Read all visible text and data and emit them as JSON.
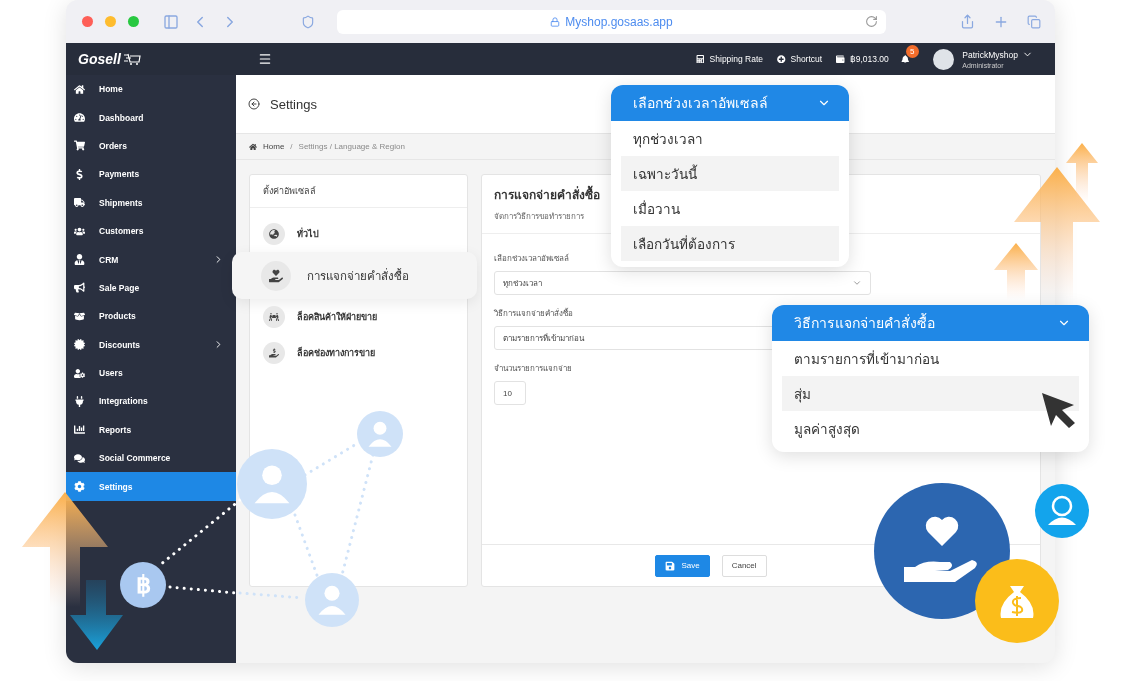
{
  "browser": {
    "url": "Myshop.gosaas.app"
  },
  "header": {
    "logo": "Gosell",
    "shipping": "Shipping Rate",
    "shortcut": "Shortcut",
    "balance": "฿9,013.00",
    "notifications": "5",
    "user_name": "PatrickMyshop",
    "user_role": "Administrator"
  },
  "sidebar": {
    "items": [
      {
        "label": "Home",
        "has_submenu": false,
        "selected": false
      },
      {
        "label": "Dashboard",
        "has_submenu": false,
        "selected": false
      },
      {
        "label": "Orders",
        "has_submenu": false,
        "selected": false
      },
      {
        "label": "Payments",
        "has_submenu": false,
        "selected": false
      },
      {
        "label": "Shipments",
        "has_submenu": false,
        "selected": false
      },
      {
        "label": "Customers",
        "has_submenu": false,
        "selected": false
      },
      {
        "label": "CRM",
        "has_submenu": true,
        "selected": false
      },
      {
        "label": "Sale Page",
        "has_submenu": false,
        "selected": false
      },
      {
        "label": "Products",
        "has_submenu": false,
        "selected": false
      },
      {
        "label": "Discounts",
        "has_submenu": true,
        "selected": false
      },
      {
        "label": "Users",
        "has_submenu": false,
        "selected": false
      },
      {
        "label": "Integrations",
        "has_submenu": false,
        "selected": false
      },
      {
        "label": "Reports",
        "has_submenu": false,
        "selected": false
      },
      {
        "label": "Social Commerce",
        "has_submenu": false,
        "selected": false
      },
      {
        "label": "Settings",
        "has_submenu": false,
        "selected": true
      }
    ]
  },
  "page": {
    "title": "Settings",
    "breadcrumb": [
      "Home",
      "/",
      "Settings / Language & Region"
    ]
  },
  "settings_menu": {
    "title": "ตั้งค่าอัพเซลล์",
    "items": [
      {
        "label": "ทั่วไป",
        "selected": false
      },
      {
        "label": "การแจกจ่ายคำสั่งซื้อ",
        "selected": true
      },
      {
        "label": "ล็อคสินค้าให้ฝ่ายขาย",
        "selected": false
      },
      {
        "label": "ล็อคช่องทางการขาย",
        "selected": false
      }
    ]
  },
  "form": {
    "title": "การแจกจ่ายคำสั่งซื้อ",
    "subtitle": "จัดการวิธีการขอทำรายการ",
    "fields": [
      {
        "kind": "select",
        "label": "เลือกช่วงเวลาอัพเซลล์",
        "value": "ทุกช่วงเวลา"
      },
      {
        "kind": "select",
        "label": "วิธีการแจกจ่ายคำสั่งซื้อ",
        "value": "ตามรายการที่เข้ามาก่อน"
      },
      {
        "kind": "number",
        "label": "จำนวนรายการแจกจ่าย",
        "value": "10"
      }
    ],
    "buttons": [
      {
        "kind": "primary",
        "label": "Save"
      },
      {
        "kind": "secondary",
        "label": "Cancel"
      }
    ]
  },
  "popovers": [
    {
      "title": "เลือกช่วงเวลาอัพเซลล์",
      "options": [
        {
          "label": "ทุกช่วงเวลา",
          "highlighted": false
        },
        {
          "label": "เฉพาะวันนี้",
          "highlighted": true
        },
        {
          "label": "เมื่อวาน",
          "highlighted": false
        },
        {
          "label": "เลือกวันที่ต้องการ",
          "highlighted": true
        }
      ]
    },
    {
      "title": "วิธีการแจกจ่ายคำสั่งซื้อ",
      "options": [
        {
          "label": "ตามรายการที่เข้ามาก่อน",
          "highlighted": false
        },
        {
          "label": "สุ่ม",
          "highlighted": true
        },
        {
          "label": "มูลค่าสูงสุด",
          "highlighted": false
        }
      ]
    }
  ],
  "decor": {
    "coin_symbol": "฿"
  }
}
